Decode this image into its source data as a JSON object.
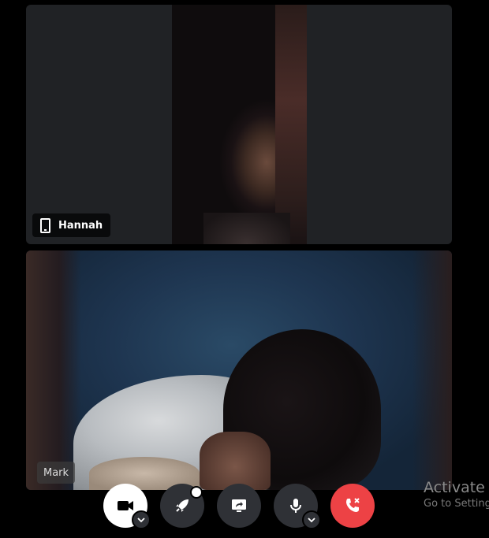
{
  "participants": [
    {
      "name": "Hannah",
      "device_icon": "mobile-phone-icon"
    },
    {
      "name": "Mark"
    }
  ],
  "controls": {
    "camera_icon": "video-camera-icon",
    "activity_icon": "rocket-icon",
    "screen_share_icon": "screen-share-icon",
    "mic_icon": "microphone-icon",
    "leave_icon": "hang-up-phone-icon"
  },
  "watermark": {
    "title": "Activate W",
    "subtitle": "Go to Setting"
  },
  "colors": {
    "background": "#000000",
    "tile": "#202225",
    "control": "#2f3136",
    "leave": "#ed4245"
  }
}
